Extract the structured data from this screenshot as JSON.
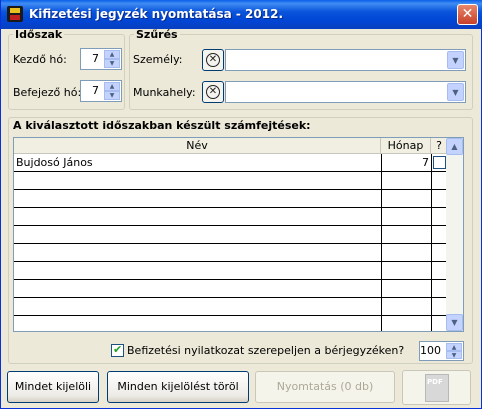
{
  "window": {
    "title": "Kifizetési jegyzék nyomtatása  -  2012.",
    "close_glyph": "✕"
  },
  "period": {
    "legend": "Időszak",
    "start_label": "Kezdő hó:",
    "start_value": "7",
    "end_label": "Befejező hó:",
    "end_value": "7"
  },
  "filter": {
    "legend": "Szűrés",
    "person_label": "Személy:",
    "person_value": "",
    "workplace_label": "Munkahely:",
    "workplace_value": ""
  },
  "list": {
    "title": "A kiválasztott időszakban készült számfejtések:",
    "columns": {
      "name": "Név",
      "month": "Hónap",
      "check": "?"
    },
    "rows": [
      {
        "name": "Bujdosó János",
        "month": "7",
        "checked": false
      }
    ]
  },
  "options": {
    "declaration_label": "Befizetési nyilatkozat szerepeljen a bérjegyzéken?",
    "declaration_checked": true,
    "copies_value": "100"
  },
  "buttons": {
    "select_all": "Mindet kijelöli",
    "deselect_all": "Minden kijelölést töröl",
    "print": "Nyomtatás (0 db)",
    "pdf_label": "PDF"
  },
  "icons": {
    "clear": "clear-filter-icon",
    "dropdown": "chevron-down-icon",
    "spin_up": "spin-up-icon",
    "spin_down": "spin-down-icon"
  }
}
